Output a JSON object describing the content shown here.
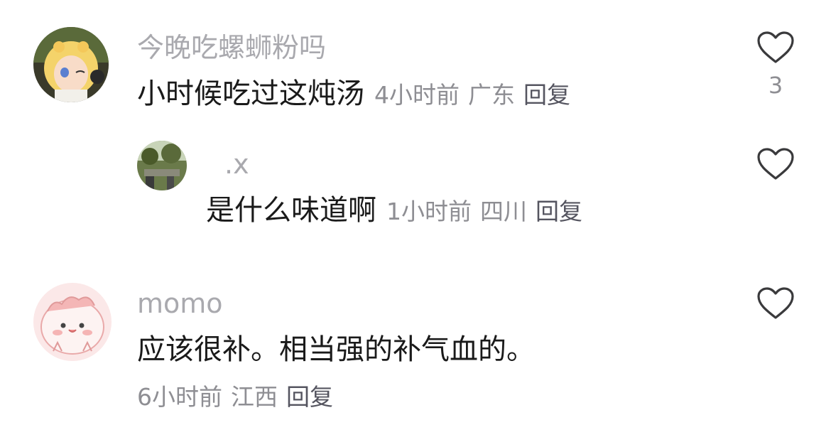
{
  "comments": [
    {
      "username": "今晚吃螺蛳粉吗",
      "text": "小时候吃过这炖汤",
      "time": "4小时前",
      "location": "广东",
      "reply_label": "回复",
      "likes": "3"
    },
    {
      "username": ".x",
      "text": "是什么味道啊",
      "time": "1小时前",
      "location": "四川",
      "reply_label": "回复",
      "likes": ""
    },
    {
      "username": "momo",
      "text": "应该很补。相当强的补气血的。",
      "time": "6小时前",
      "location": "江西",
      "reply_label": "回复",
      "likes": ""
    }
  ],
  "icons": {
    "like": "heart-outline-icon"
  },
  "colors": {
    "username": "#a9a9ae",
    "content": "#1a1a1a",
    "meta": "#8e8e93",
    "heart_stroke": "#3a3a3c"
  }
}
